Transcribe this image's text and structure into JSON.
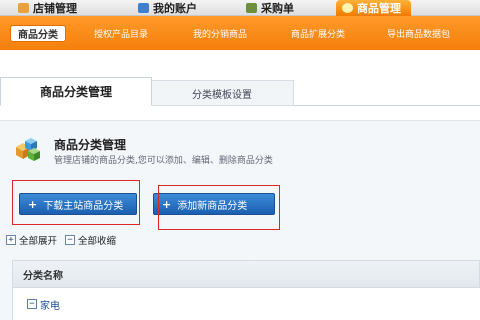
{
  "top_nav": {
    "items": [
      {
        "label": "店铺管理"
      },
      {
        "label": "我的账户"
      },
      {
        "label": "采购单"
      },
      {
        "label": "商品管理"
      }
    ]
  },
  "sub_nav": {
    "items": [
      {
        "label": "商品分类"
      },
      {
        "label": "授权产品目录"
      },
      {
        "label": "我的分销商品"
      },
      {
        "label": "商品扩展分类"
      },
      {
        "label": "导出商品数据包"
      }
    ]
  },
  "tabs": [
    {
      "label": "商品分类管理"
    },
    {
      "label": "分类模板设置"
    }
  ],
  "panel": {
    "title": "商品分类管理",
    "description": "管理店铺的商品分类,您可以添加、编辑、删除商品分类"
  },
  "buttons": {
    "download": "下载主站商品分类",
    "add": "添加新商品分类"
  },
  "tree": {
    "expand_all": "全部展开",
    "collapse_all": "全部收缩",
    "expand_symbol": "+",
    "collapse_symbol": "−"
  },
  "table": {
    "header": "分类名称",
    "rows": [
      {
        "name": "家电"
      }
    ]
  },
  "colors": {
    "accent_orange": "#f57f0b",
    "button_blue": "#1b5fb0",
    "highlight_red": "#d8282a"
  }
}
